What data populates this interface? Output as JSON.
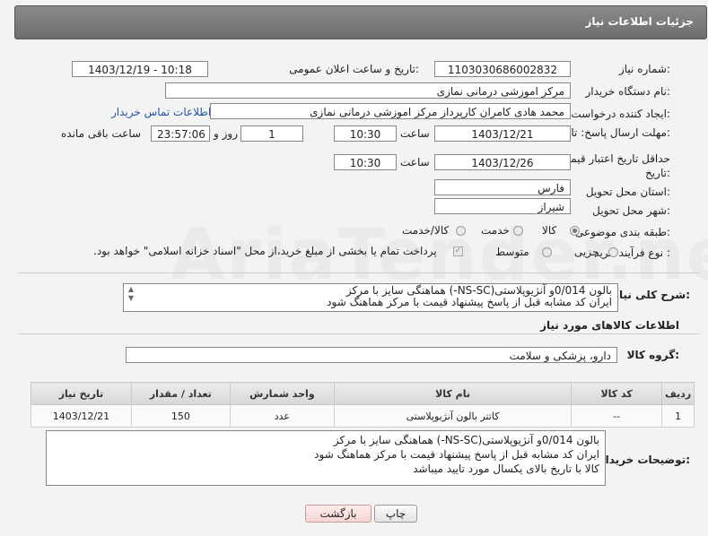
{
  "header": {
    "title": "جزئیات اطلاعات نیاز"
  },
  "form": {
    "need_number_label": "شماره نیاز:",
    "need_number": "1103030686002832",
    "announce_label": "تاریخ و ساعت اعلان عمومی:",
    "announce_value": "1403/12/19 - 10:18",
    "buyer_org_label": "نام دستگاه خریدار:",
    "buyer_org": "مرکز اموزشی درمانی نمازی",
    "creator_label": "ایجاد کننده درخواست:",
    "creator": "محمد هادی کامران کارپرداز مرکز اموزشی درمانی نمازی",
    "contact_link": "اطلاعات تماس خریدار",
    "deadline_label": "مهلت ارسال پاسخ: تا تاریخ:",
    "deadline_date": "1403/12/21",
    "time_label": "ساعت",
    "deadline_time": "10:30",
    "days_value": "1",
    "days_label": "روز و",
    "remaining_time": "23:57:06",
    "remaining_label": "ساعت باقی مانده",
    "validity_label": "حداقل تاریخ اعتبار قیمت: تا تاریخ:",
    "validity_date": "1403/12/26",
    "validity_time": "10:30",
    "province_label": "استان محل تحویل:",
    "province": "فارس",
    "city_label": "شهر محل تحویل:",
    "city": "شیراز",
    "category_label": "طبقه بندی موضوعی:",
    "category_options": [
      "کالا",
      "خدمت",
      "کالا/خدمت"
    ],
    "process_label": "نوع فرآیند خرید :",
    "process_options": [
      "جزیی",
      "متوسط"
    ],
    "payment_note": "پرداخت تمام یا بخشی از مبلغ خرید،از محل \"اسناد خزانه اسلامی\" خواهد بود.",
    "description_label": "شرح کلی نیاز:",
    "description": "بالون 0/014و  آنژیوپلاستی(NS-SC-) هماهنگی سایز با مرکز\nایران کد مشابه قبل از پاسخ پیشنهاد قیمت با مرکز هماهنگ شود"
  },
  "goods": {
    "section_title": "اطلاعات کالاهای مورد نیاز",
    "group_label": "گروه کالا:",
    "group_value": "دارو، پزشکی و سلامت",
    "columns": [
      "ردیف",
      "کد کالا",
      "نام کالا",
      "واحد شمارش",
      "تعداد / مقدار",
      "تاریخ نیاز"
    ],
    "rows": [
      {
        "row": "1",
        "code": "--",
        "name": "کاتتر بالون آنژیوپلاستی",
        "unit": "عدد",
        "qty": "150",
        "date": "1403/12/21"
      }
    ]
  },
  "buyer_notes": {
    "label": "توضیحات خریدار:",
    "text": "بالون 0/014و  آنژیوپلاستی(NS-SC-) هماهنگی سایز با مرکز\nایران کد مشابه قبل از پاسخ پیشنهاد قیمت با مرکز هماهنگ شود\nکالا با تاریخ بالای یکسال مورد تایید میباشد"
  },
  "buttons": {
    "print": "چاپ",
    "back": "بازگشت"
  },
  "watermark": "AriaTender.neT"
}
